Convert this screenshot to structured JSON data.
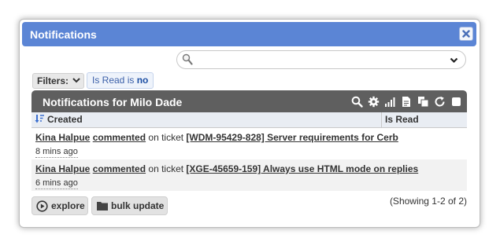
{
  "dialog": {
    "title": "Notifications"
  },
  "search": {
    "value": "",
    "placeholder": ""
  },
  "filters": {
    "button_label": "Filters:",
    "chip_prefix": "Is Read is",
    "chip_value": "no"
  },
  "worklist": {
    "title": "Notifications for Milo Dade",
    "toolbar_icons": [
      "search-icon",
      "gear-icon",
      "signal-bars-icon",
      "export-icon",
      "copy-icon",
      "refresh-icon",
      "select-all-checkbox"
    ],
    "columns": {
      "created": "Created",
      "is_read": "Is Read"
    },
    "rows": [
      {
        "actor": "Kina Halpue",
        "verb": "commented",
        "middle": " on ticket ",
        "target": "[WDM-95429-828] Server requirements for Cerb",
        "time": "8 mins ago"
      },
      {
        "actor": "Kina Halpue",
        "verb": "commented",
        "middle": " on ticket ",
        "target": "[XGE-45659-159] Always use HTML mode on replies",
        "time": "6 mins ago"
      }
    ],
    "explore_label": "explore",
    "bulk_update_label": "bulk update",
    "showing_text": "(Showing 1-2 of 2)"
  },
  "colors": {
    "titlebar": "#5b85d5",
    "worklist_header": "#5f5f5f",
    "column_header": "#e9edf3"
  }
}
